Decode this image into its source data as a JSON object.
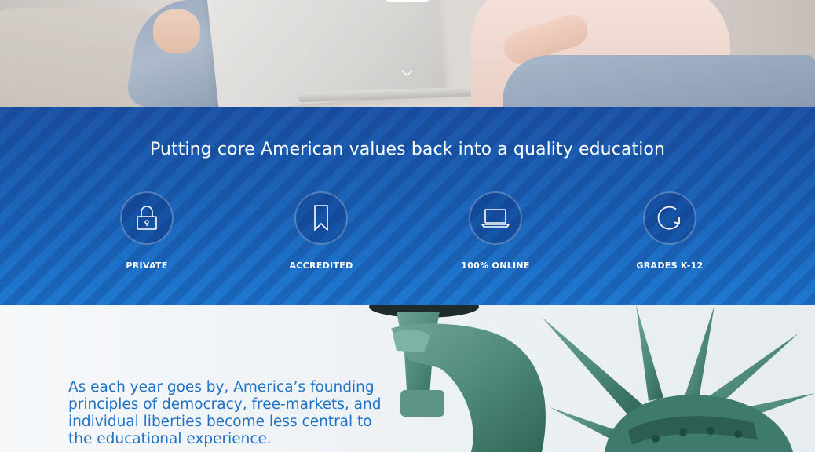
{
  "hero": {
    "icons": {
      "scroll": "chevron-down-icon"
    }
  },
  "values_band": {
    "headline": "Putting core American values back into a quality education",
    "features": [
      {
        "label": "PRIVATE",
        "icon": "lock-icon"
      },
      {
        "label": "ACCREDITED",
        "icon": "bookmark-icon"
      },
      {
        "label": "100% ONLINE",
        "icon": "laptop-icon"
      },
      {
        "label": "GRADES K-12",
        "icon": "refresh-icon"
      }
    ],
    "colors": {
      "band_top": "#1d55a8",
      "band_bottom": "#1e78d0",
      "text": "#ffffff"
    }
  },
  "liberty_section": {
    "paragraph": "As each year goes by, America’s founding principles of democracy, free-markets, and individual liberties become less central to the educational experience.",
    "colors": {
      "text": "#1f72c6",
      "statue": "#4f8a7a"
    }
  }
}
